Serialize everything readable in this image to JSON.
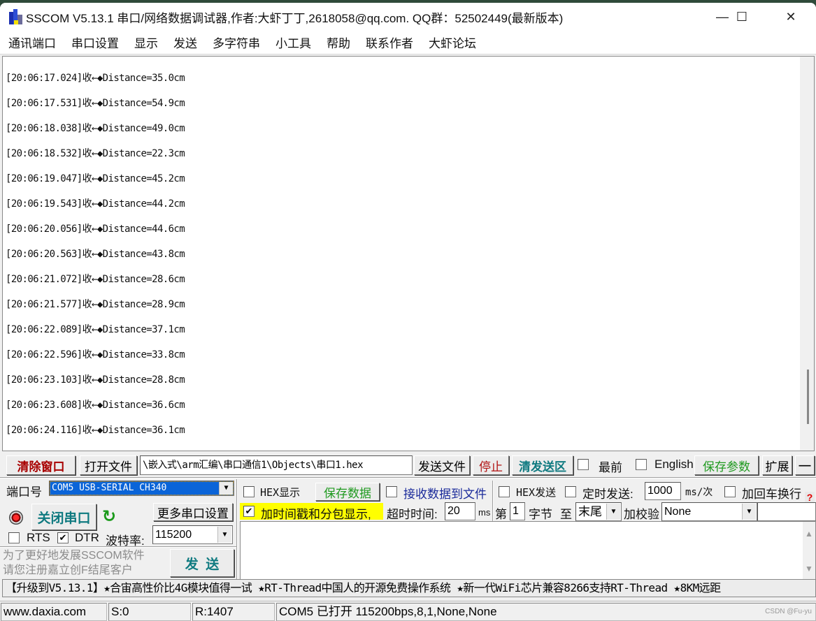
{
  "window": {
    "title": "SSCOM V5.13.1 串口/网络数据调试器,作者:大虾丁丁,2618058@qq.com. QQ群：52502449(最新版本)",
    "controls": {
      "minimize": "—",
      "maximize": "☐",
      "close": "✕"
    }
  },
  "menu": [
    "通讯端口",
    "串口设置",
    "显示",
    "发送",
    "多字符串",
    "小工具",
    "帮助",
    "联系作者",
    "大虾论坛"
  ],
  "receive_log": [
    "[20:06:17.024]收←◆Distance=35.0cm",
    "[20:06:17.531]收←◆Distance=54.9cm",
    "[20:06:18.038]收←◆Distance=49.0cm",
    "[20:06:18.532]收←◆Distance=22.3cm",
    "[20:06:19.047]收←◆Distance=45.2cm",
    "[20:06:19.543]收←◆Distance=44.2cm",
    "[20:06:20.056]收←◆Distance=44.6cm",
    "[20:06:20.563]收←◆Distance=43.8cm",
    "[20:06:21.072]收←◆Distance=28.6cm",
    "[20:06:21.577]收←◆Distance=28.9cm",
    "[20:06:22.089]收←◆Distance=37.1cm",
    "[20:06:22.596]收←◆Distance=33.8cm",
    "[20:06:23.103]收←◆Distance=28.8cm",
    "[20:06:23.608]收←◆Distance=36.6cm",
    "[20:06:24.116]收←◆Distance=36.1cm"
  ],
  "toolbar": {
    "clear_window": "清除窗口",
    "open_file": "打开文件",
    "file_path": "\\嵌入式\\arm汇编\\串口通信1\\Objects\\串口1.hex",
    "send_file": "发送文件",
    "stop": "停止",
    "clear_send": "清发送区",
    "topmost": {
      "label": "最前",
      "checked": false
    },
    "english": {
      "label": "English",
      "checked": false
    },
    "save_params": "保存参数",
    "expand": "扩展",
    "collapse": "—"
  },
  "port": {
    "port_label": "端口号",
    "port_value": "COM5 USB-SERIAL CH340",
    "close_port": "关闭串口",
    "more_settings": "更多串口设置",
    "rts": {
      "label": "RTS",
      "checked": false
    },
    "dtr": {
      "label": "DTR",
      "checked": true
    },
    "baud_label": "波特率:",
    "baud_value": "115200",
    "promo_line1": "为了更好地发展SSCOM软件",
    "promo_line2": "请您注册嘉立创F结尾客户",
    "send": "发  送"
  },
  "options": {
    "hex_display": {
      "label": "HEX显示",
      "checked": false
    },
    "save_data": "保存数据",
    "recv_to_file": {
      "label": "接收数据到文件",
      "checked": false
    },
    "hex_send": {
      "label": "HEX发送",
      "checked": false
    },
    "timed_send": {
      "label": "定时发送:",
      "checked": false
    },
    "timed_interval": "1000",
    "timed_unit": "ms/次",
    "add_crlf": {
      "label": "加回车换行",
      "checked": false
    },
    "timestamp": {
      "label": "加时间戳和分包显示,",
      "checked": true
    },
    "timeout_label": "超时时间:",
    "timeout_value": "20",
    "timeout_unit": "ms",
    "byte_from_label": "第",
    "byte_from_value": "1",
    "byte_unit": "字节",
    "to_label": "至",
    "to_value": "末尾",
    "checksum_label": "加校验",
    "checksum_value": "None",
    "help": "?"
  },
  "send_text": "",
  "ticker": "【升级到V5.13.1】★合宙高性价比4G模块值得一试 ★RT-Thread中国人的开源免费操作系统 ★新一代WiFi芯片兼容8266支持RT-Thread ★8KM远距",
  "status": {
    "website": "www.daxia.com",
    "sent": "S:0",
    "received": "R:1407",
    "port_state": "COM5 已打开  115200bps,8,1,None,None",
    "watermark": "CSDN @Fu-yu"
  }
}
